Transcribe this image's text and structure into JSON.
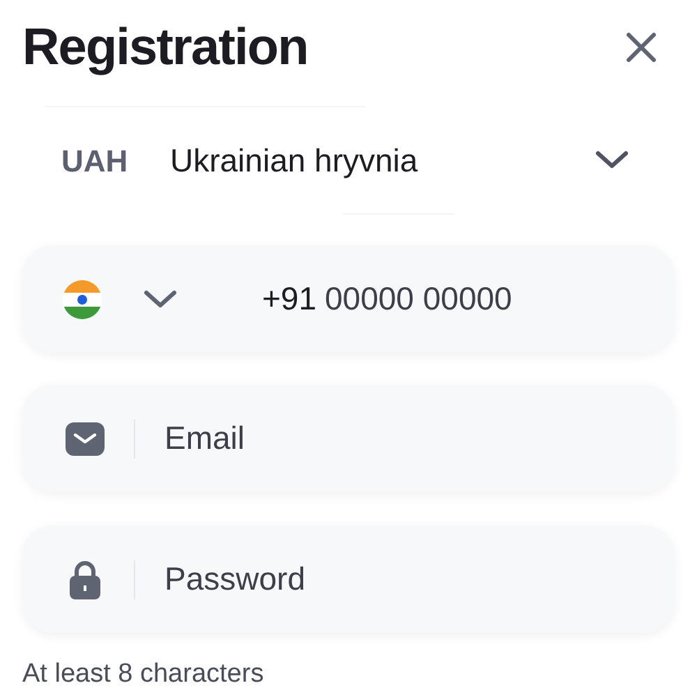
{
  "header": {
    "title": "Registration"
  },
  "currency": {
    "code": "UAH",
    "name": "Ukrainian hryvnia"
  },
  "phone": {
    "prefix": "+91",
    "placeholder": "00000 00000"
  },
  "fields": [
    {
      "kind": "email",
      "placeholder": "Email"
    },
    {
      "kind": "password",
      "placeholder": "Password"
    }
  ],
  "hint": "At least 8 characters"
}
